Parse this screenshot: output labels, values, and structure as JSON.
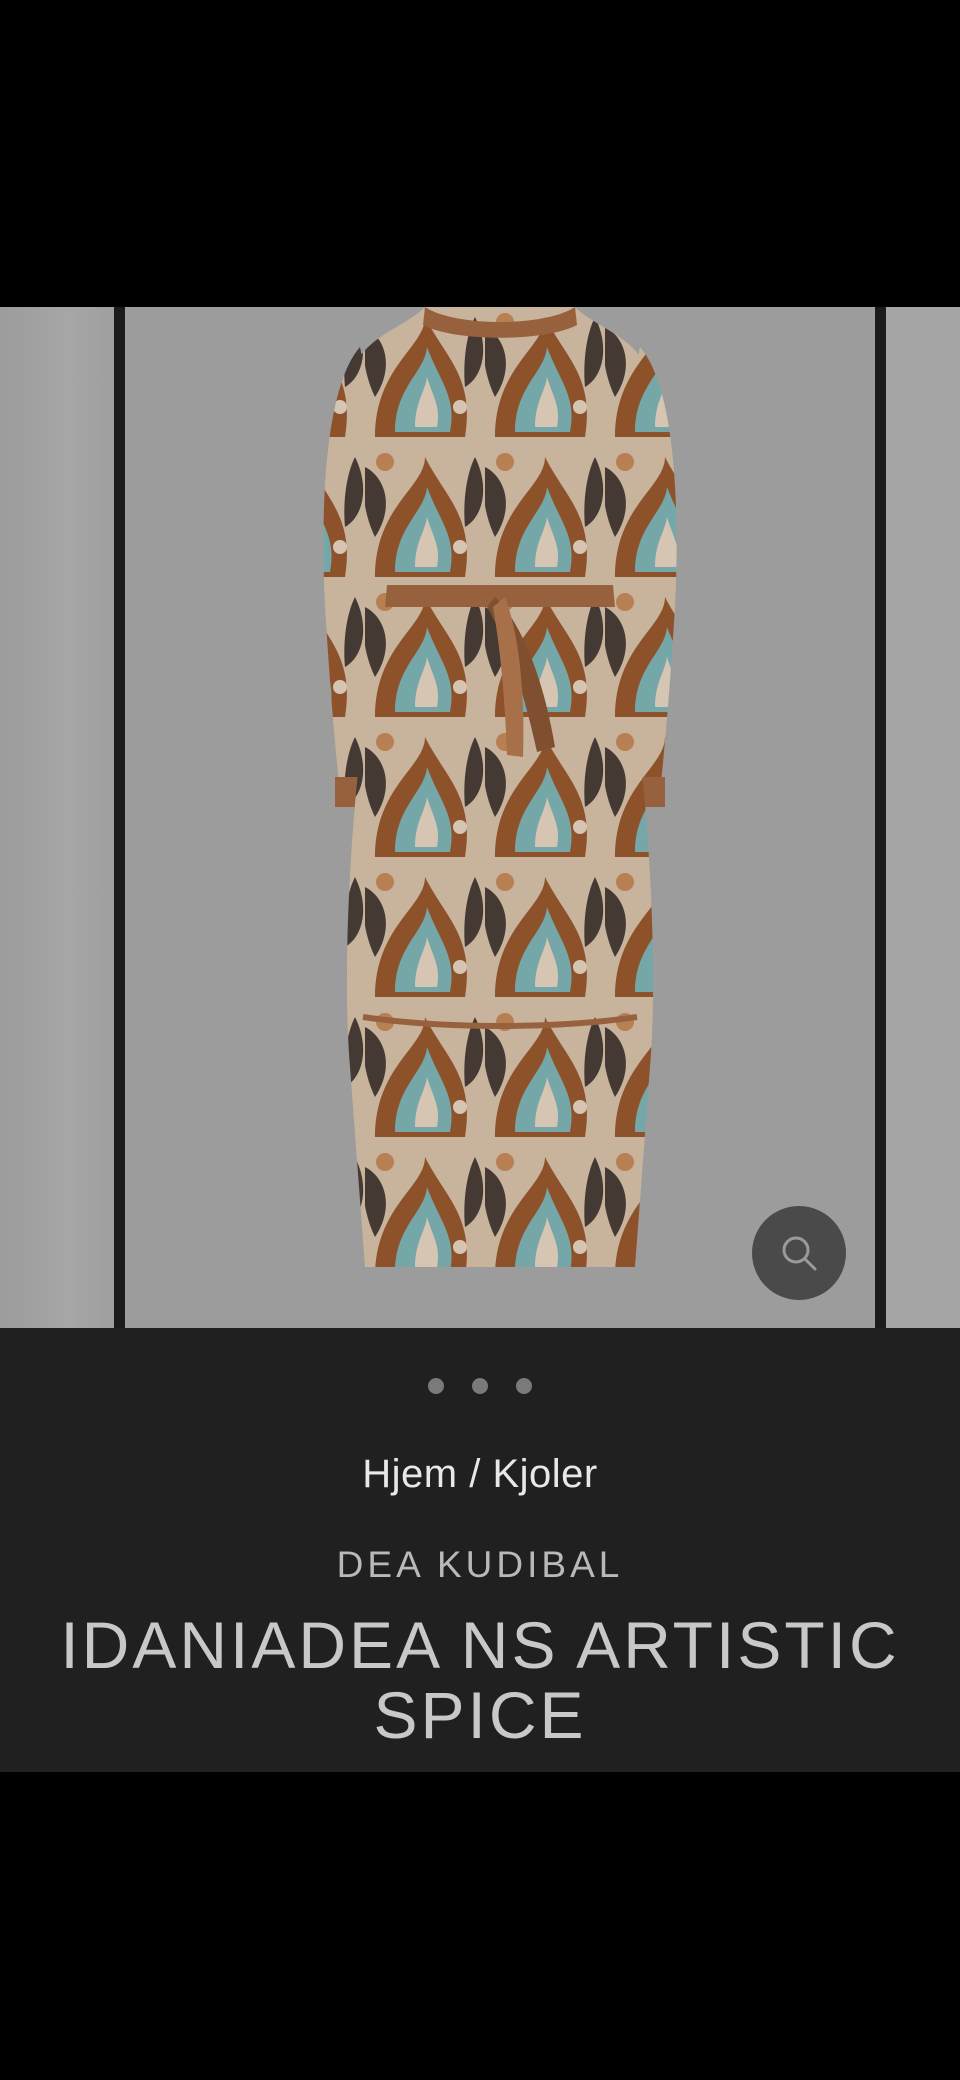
{
  "gallery": {
    "dots": [
      "slide-1",
      "slide-2",
      "slide-3"
    ],
    "zoom_icon": "search-icon"
  },
  "product": {
    "breadcrumb": "Hjem / Kjoler",
    "brand": "DEA KUDIBAL",
    "title": "IDANIADEA NS ARTISTIC SPICE"
  },
  "colors": {
    "background": "#000000",
    "info_panel": "#202020",
    "image_backdrop": "#aaaaaa",
    "dress_brown": "#9b5a2e",
    "dress_teal": "#7fb6b8",
    "dress_cream": "#e8d6c2",
    "dress_dark": "#4a3f38"
  }
}
